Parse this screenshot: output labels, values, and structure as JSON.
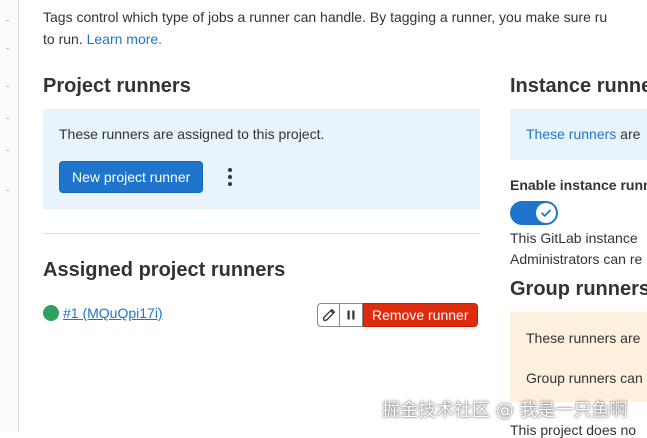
{
  "intro": {
    "line1": "Tags control which type of jobs a runner can handle. By tagging a runner, you make sure ru",
    "line2_prefix": "to run.",
    "learn_more": "Learn more."
  },
  "project_runners": {
    "title": "Project runners",
    "description": "These runners are assigned to this project.",
    "new_button": "New project runner"
  },
  "assigned": {
    "title": "Assigned project runners",
    "runners": [
      {
        "label": "#1 (MQuQpi17i)",
        "status": "online",
        "remove_label": "Remove runner"
      }
    ]
  },
  "instance_runners": {
    "title": "Instance runne",
    "link_text": "These runners",
    "suffix": " are",
    "enable_label": "Enable instance runn",
    "toggle_on": true,
    "help_line1": "This GitLab instance",
    "help_line2": "Administrators can re"
  },
  "group_runners": {
    "title": "Group runners",
    "line1": "These runners are",
    "line2": "Group runners can",
    "bottom": "This project does no"
  },
  "watermark": "掘金技术社区 @ 我是一只鱼啊",
  "colors": {
    "primary": "#1f75cb",
    "danger": "#dd2b0e",
    "success": "#2da160",
    "info_bg": "#e9f3fc",
    "warning_bg": "#fdf1dd"
  }
}
